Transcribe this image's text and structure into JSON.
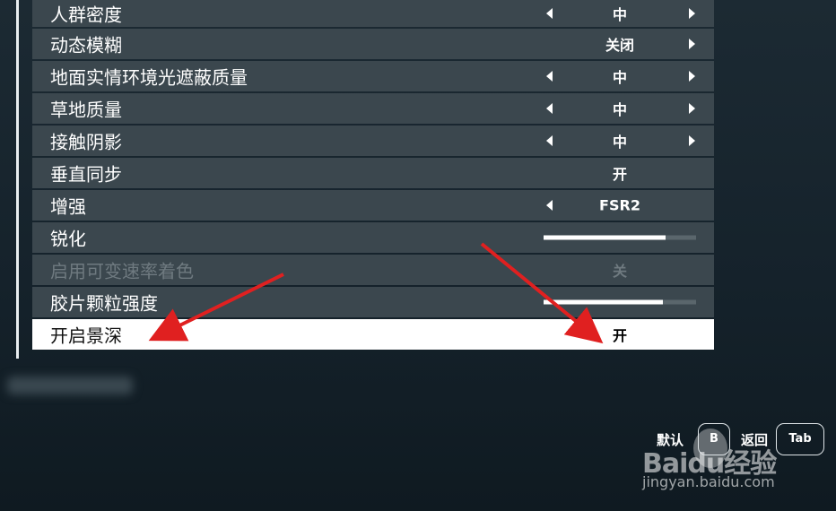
{
  "settings": [
    {
      "label": "人群密度",
      "value": "中",
      "left_arrow": true,
      "right_arrow": true
    },
    {
      "label": "动态模糊",
      "value": "关闭",
      "left_arrow": false,
      "right_arrow": true
    },
    {
      "label": "地面实情环境光遮蔽质量",
      "value": "中",
      "left_arrow": true,
      "right_arrow": true
    },
    {
      "label": "草地质量",
      "value": "中",
      "left_arrow": true,
      "right_arrow": true
    },
    {
      "label": "接触阴影",
      "value": "中",
      "left_arrow": true,
      "right_arrow": true
    },
    {
      "label": "垂直同步",
      "value": "开",
      "left_arrow": false,
      "right_arrow": false
    },
    {
      "label": "增强",
      "value": "FSR2",
      "left_arrow": true,
      "right_arrow": false
    },
    {
      "label": "锐化",
      "slider_fraction": 0.8
    },
    {
      "label": "启用可变速率着色",
      "value": "关",
      "disabled": true
    },
    {
      "label": "胶片颗粒强度",
      "slider_fraction": 0.78
    },
    {
      "label": "开启景深",
      "value": "开",
      "selected": true
    }
  ],
  "bottom": {
    "default_label": "默认",
    "default_key": "B",
    "back_label": "返回",
    "back_key": "Tab"
  },
  "watermark": {
    "logo": "Baidu经验",
    "url": "jingyan.baidu.com"
  },
  "colors": {
    "row_bg": "#3b474e",
    "selected_bg": "#ffffff",
    "annotation_arrow": "#e02020"
  }
}
